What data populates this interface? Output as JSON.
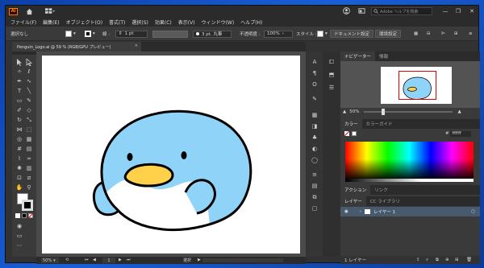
{
  "app": {
    "logo_text": "Ai",
    "search_placeholder": "Adobe ヘルプを検索",
    "window_controls": [
      "minimize-icon",
      "restore-icon",
      "close-icon"
    ]
  },
  "menu": [
    "ファイル(F)",
    "編集(E)",
    "オブジェクト(O)",
    "書式(T)",
    "選択(S)",
    "効果(C)",
    "表示(V)",
    "ウィンドウ(W)",
    "ヘルプ(H)"
  ],
  "control_bar": {
    "selection": "選択なし",
    "stroke_label": "線 :",
    "stroke_value": "1 pt",
    "profile_value": "3 pt. 丸筆",
    "opacity_label": "不透明度 :",
    "opacity_value": "100%",
    "style_label": "スタイル :",
    "doc_settings": "ドキュメント設定",
    "preferences": "環境設定"
  },
  "document": {
    "tab_label": "Penguin_Logo.ai @ 59 % (RGB/GPU プレビュー)",
    "close": "×"
  },
  "statusbar": {
    "zoom": "50%",
    "artboard_num": "1",
    "tool_name": "選択"
  },
  "panels": {
    "navigator": {
      "tabs": [
        "ナビゲーター",
        "情報"
      ],
      "zoom": "50%"
    },
    "color": {
      "tabs": [
        "カラー",
        "カラーガイド"
      ],
      "hex_prefix": "#",
      "hex_value": "ffffff"
    },
    "actions": {
      "tabs": [
        "アクション",
        "リンク"
      ]
    },
    "layers": {
      "tabs": [
        "レイヤー",
        "CC ライブラリ"
      ],
      "rows": [
        {
          "name": "レイヤー 1"
        }
      ],
      "footer": "1 レイヤー"
    }
  },
  "colors": {
    "penguin_body": "#8fd4f8",
    "penguin_belly": "#ffffff",
    "penguin_beak": "#ffd14a",
    "accent_red": "#e00000",
    "layer_highlight": "#475a6e"
  }
}
